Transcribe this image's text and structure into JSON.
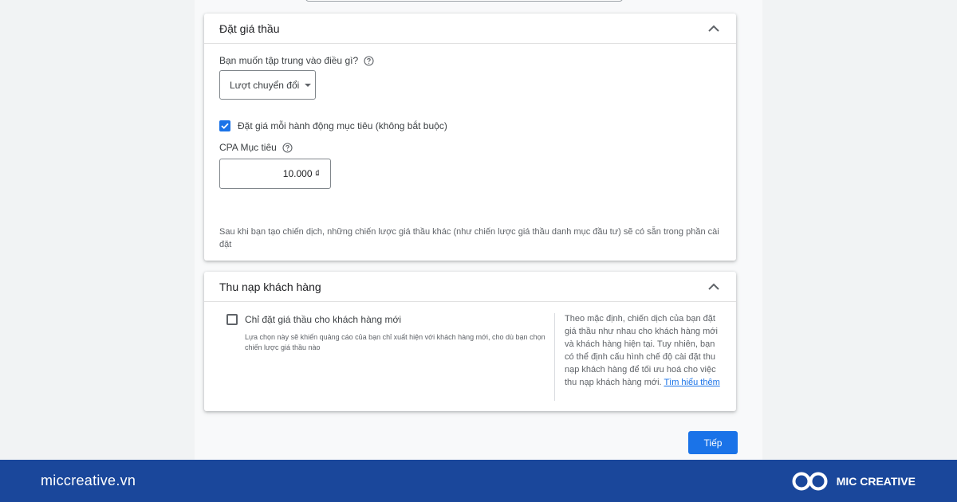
{
  "bidding_card": {
    "title": "Đặt giá thầu",
    "focus_label": "Bạn muốn tập trung vào điều gì?",
    "focus_value": "Lượt chuyển đổi",
    "target_checkbox_label": "Đặt giá mỗi hành động mục tiêu (không bắt buộc)",
    "target_checkbox_checked": true,
    "cpa_label": "CPA Mục tiêu",
    "cpa_value": "10.000 ₫",
    "note": "Sau khi bạn tạo chiến dịch, những chiến lược giá thầu khác (như chiến lược giá thầu danh mục đầu tư) sẽ có sẵn trong phần cài đặt"
  },
  "acquisition_card": {
    "title": "Thu nạp khách hàng",
    "checkbox_label": "Chỉ đặt giá thầu cho khách hàng mới",
    "checkbox_checked": false,
    "checkbox_description": "Lựa chọn này sẽ khiến quảng cáo của bạn chỉ xuất hiện với khách hàng mới, cho dù bạn chọn chiến lược giá thầu nào",
    "side_text": "Theo mặc định, chiến dịch của bạn đặt giá thầu như nhau cho khách hàng mới và khách hàng hiện tại. Tuy nhiên, bạn có thể định cấu hình chế độ cài đặt thu nạp khách hàng để tối ưu hoá cho việc thu nạp khách hàng mới.",
    "learn_more": "Tìm hiểu thêm"
  },
  "actions": {
    "next_label": "Tiếp"
  },
  "footer": {
    "url": "miccreative.vn",
    "brand": "MIC CREATIVE"
  },
  "colors": {
    "primary": "#1a73e8",
    "footer_bg": "#1a479b"
  }
}
